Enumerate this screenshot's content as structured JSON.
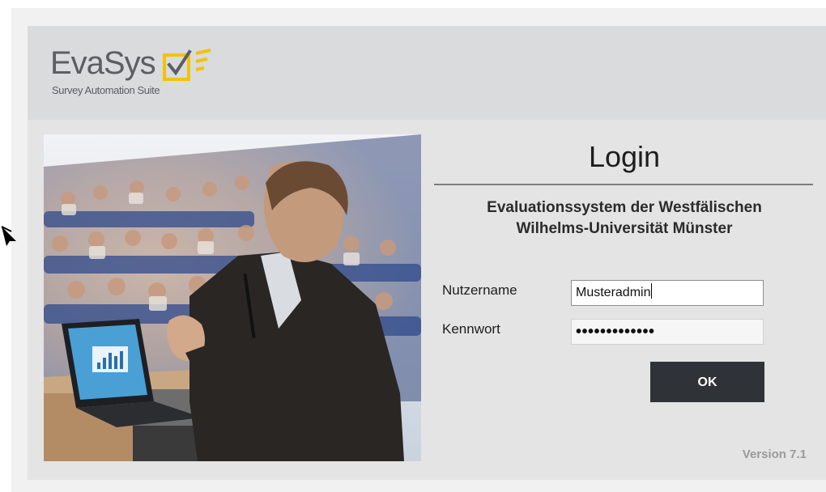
{
  "logo": {
    "name": "EvaSys",
    "tagline": "Survey Automation Suite",
    "mark_color": "#f3c300",
    "text_color": "#5a5f62"
  },
  "photo": {
    "subject": "presenter-at-lectern-in-lecture-hall"
  },
  "login": {
    "title": "Login",
    "institution_line1": "Evaluationssystem der Westfälischen",
    "institution_line2": "Wilhelms-Universität Münster",
    "username_label": "Nutzername",
    "username_value": "Musteradmin",
    "password_label": "Kennwort",
    "password_mask": "•••••••••••••",
    "submit_label": "OK"
  },
  "footer": {
    "version": "Version 7.1"
  },
  "colors": {
    "button_bg": "#2f3236",
    "header_bg": "#d9dbdc",
    "panel_bg": "#e4e4e4"
  }
}
